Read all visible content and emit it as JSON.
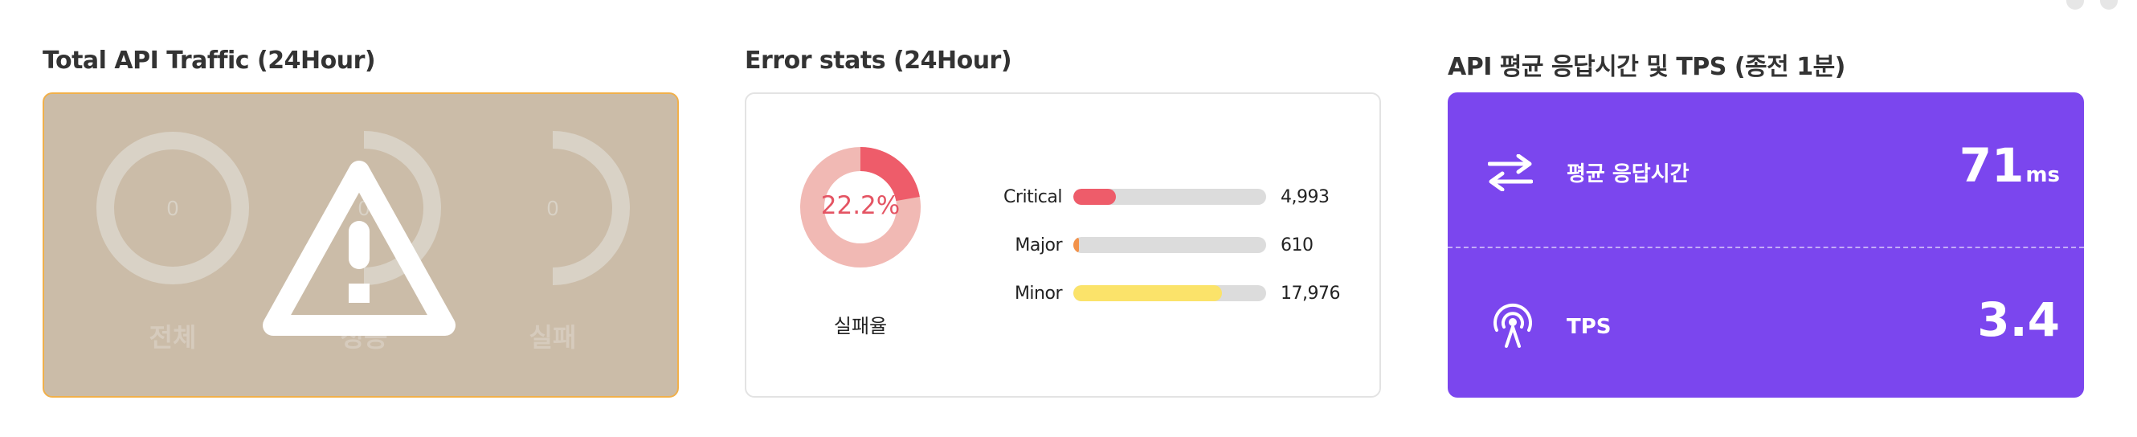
{
  "sections": {
    "traffic": {
      "title": "Total API Traffic (24Hour)",
      "gauges": [
        {
          "label": "전체",
          "value": "0"
        },
        {
          "label": "성공",
          "value": "0"
        },
        {
          "label": "실패",
          "value": "0"
        }
      ],
      "overlay_icon": "warning-icon"
    },
    "errors": {
      "title": "Error stats (24Hour)",
      "failure_rate": {
        "value": "22.2%",
        "percent": 22.2,
        "caption": "실패율"
      },
      "bars": [
        {
          "name": "Critical",
          "value": "4,993",
          "fraction": 0.22,
          "color": "#ee5c6a"
        },
        {
          "name": "Major",
          "value": "610",
          "fraction": 0.03,
          "color": "#f2924a"
        },
        {
          "name": "Minor",
          "value": "17,976",
          "fraction": 0.77,
          "color": "#fbe36a"
        }
      ]
    },
    "performance": {
      "title": "API 평균 응답시간 및 TPS (종전 1분)",
      "avg_response": {
        "label": "평균 응답시간",
        "value": "71",
        "unit": "ms",
        "icon": "transfer-arrows-icon"
      },
      "tps": {
        "label": "TPS",
        "value": "3.4",
        "icon": "antenna-icon"
      }
    }
  },
  "colors": {
    "traffic_bg": "#cbbca8",
    "traffic_border": "#f1b04a",
    "perf_bg": "#7b46ee",
    "donut_fill": "#ee5c6a",
    "donut_track": "#f1b9b4"
  }
}
